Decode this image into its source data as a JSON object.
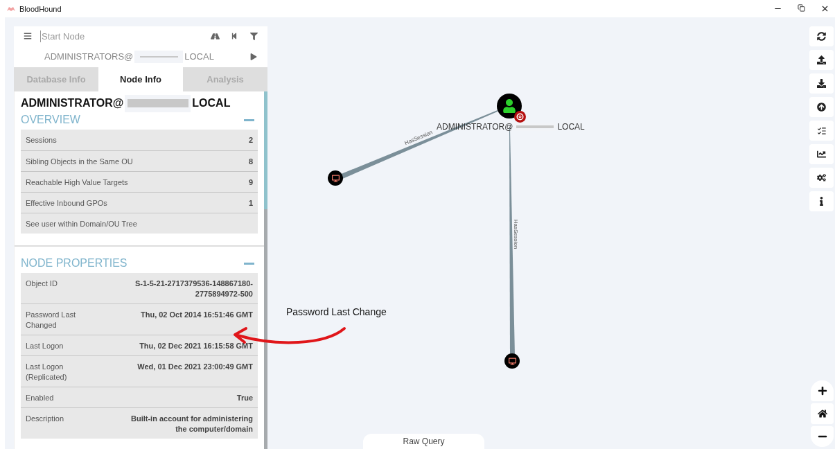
{
  "window": {
    "title": "BloodHound"
  },
  "search": {
    "placeholder": "Start Node",
    "start_node": {
      "prefix": "ADMINISTRATORS@",
      "suffix": "LOCAL"
    }
  },
  "tabs": [
    {
      "label": "Database Info",
      "selected": false
    },
    {
      "label": "Node Info",
      "selected": true
    },
    {
      "label": "Analysis",
      "selected": false
    }
  ],
  "node_info": {
    "title_prefix": "ADMINISTRATOR@",
    "title_suffix": "LOCAL",
    "overview": {
      "heading": "OVERVIEW",
      "expanded": true,
      "rows": [
        {
          "label": "Sessions",
          "value": "2"
        },
        {
          "label": "Sibling Objects in the Same OU",
          "value": "8"
        },
        {
          "label": "Reachable High Value Targets",
          "value": "9"
        },
        {
          "label": "Effective Inbound GPOs",
          "value": "1"
        },
        {
          "label": "See user within Domain/OU Tree"
        }
      ]
    },
    "node_properties": {
      "heading": "NODE PROPERTIES",
      "expanded": true,
      "rows": [
        {
          "label": "Object ID",
          "value": "S-1-5-21-2717379536-148867180-2775894972-500"
        },
        {
          "label": "Password Last Changed",
          "value": "Thu, 02 Oct 2014 16:51:46 GMT"
        },
        {
          "label": "Last Logon",
          "value": "Thu, 02 Dec 2021 16:15:58 GMT"
        },
        {
          "label": "Last Logon (Replicated)",
          "value": "Wed, 01 Dec 2021 23:00:49 GMT"
        },
        {
          "label": "Enabled",
          "value": "True"
        },
        {
          "label": "Description",
          "value": "Built-in account for administering the computer/domain"
        }
      ]
    }
  },
  "graph": {
    "nodes": [
      {
        "kind": "user",
        "label_prefix": "ADMINISTRATOR@",
        "label_suffix": "LOCAL",
        "high_value": true
      },
      {
        "kind": "computer"
      },
      {
        "kind": "computer"
      }
    ],
    "edges": [
      {
        "label": "HasSession"
      },
      {
        "label": "HasSession"
      }
    ]
  },
  "raw_query": {
    "label": "Raw Query"
  },
  "annotation": {
    "text": "Password Last Change"
  }
}
